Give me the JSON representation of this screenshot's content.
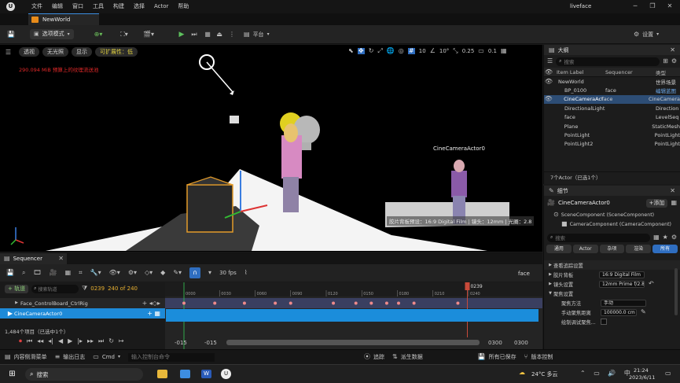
{
  "window": {
    "project": "NewWorld",
    "app_title": "liveface"
  },
  "menu": [
    "文件",
    "编辑",
    "窗口",
    "工具",
    "构建",
    "选择",
    "Actor",
    "帮助"
  ],
  "toolbar": {
    "mode": "选项模式",
    "platform": "平台",
    "settings": "设置"
  },
  "viewport": {
    "btn_perspective": "透视",
    "btn_lit": "无光照",
    "btn_show": "显示",
    "btn_scalability": "可扩展性：低",
    "warning": "290.094 MiB 预算上的纹理流送池",
    "grid_snap": "10",
    "rot_snap": "10°",
    "scale_snap": "0.25",
    "cam_speed": "0.1",
    "camera_label": "CineCameraActor0",
    "filmback_text": "胶片背板预设：16:9 Digital Film | 镜头：12mm | 光圈：2.8"
  },
  "outliner": {
    "title": "大纲",
    "search_placeholder": "搜索",
    "columns": {
      "label": "Item Label",
      "sequencer": "Sequencer",
      "type": "类型"
    },
    "rows": [
      {
        "label": "NewWorld",
        "seq": "",
        "type": "世界场景"
      },
      {
        "label": "BP_0100",
        "seq": "face",
        "type": "编辑蓝图"
      },
      {
        "label": "CineCameraActor0",
        "seq": "face",
        "type": "CineCamera"
      },
      {
        "label": "DirectionalLight",
        "seq": "",
        "type": "Direction"
      },
      {
        "label": "face",
        "seq": "",
        "type": "LevelSeq"
      },
      {
        "label": "Plane",
        "seq": "",
        "type": "StaticMesh"
      },
      {
        "label": "PointLight",
        "seq": "",
        "type": "PointLight"
      },
      {
        "label": "PointLight2",
        "seq": "",
        "type": "PointLight"
      }
    ],
    "footer": "7个Actor（已选1个）"
  },
  "details": {
    "title": "细节",
    "actor_name": "CineCameraActor0",
    "add": "+添加",
    "components": [
      "SceneComponent (SceneComponent)",
      "CameraComponent (CameraComponent)"
    ],
    "search_placeholder": "搜索",
    "filters": [
      "通用",
      "Actor",
      "杂项",
      "渲染",
      "所有"
    ],
    "sections": {
      "lookat": "查看追踪设置",
      "filmback": "胶片背板",
      "lens": "镜头设置",
      "focus": "聚焦设置"
    },
    "filmback_value": "16:9 Digital Film",
    "lens_value": "12mm Prime f/2.8",
    "focus_method_label": "聚焦方法",
    "focus_method_value": "手动",
    "focus_distance_label": "手动聚焦距离",
    "focus_distance_value": "100000.0 cm",
    "debug_focus_label": "绘制调试聚焦..."
  },
  "sequencer": {
    "tab": "Sequencer",
    "add_track": "+ 轨道",
    "search_placeholder": "搜索轨道",
    "frame_current": "0239",
    "frame_range": "240 of 240",
    "fps": "30 fps",
    "seq_name": "face",
    "playhead_label": "0239",
    "tracks": [
      {
        "label": "Face_ControlBoard_CtrlRig",
        "selected": false
      },
      {
        "label": "CineCameraActor0",
        "selected": true
      }
    ],
    "item_count": "1,484个项目（已选中1个）",
    "ticks": [
      "0000",
      "0030",
      "0060",
      "0090",
      "0120",
      "0150",
      "0180",
      "0210",
      "0240"
    ],
    "range_start": "-015",
    "range_start2": "-015",
    "range_end": "0300",
    "range_end2": "0300",
    "keyframes": [
      0,
      26,
      51,
      77,
      90,
      126,
      145,
      158,
      171,
      181,
      194,
      231
    ]
  },
  "statusbar": {
    "content_drawer": "内容侧滑菜单",
    "output_log": "输出日志",
    "cmd": "Cmd",
    "console_placeholder": "输入控制台命令",
    "trace": "追踪",
    "derived": "派生数据",
    "save_all": "所有已保存",
    "source_control": "版本控制"
  },
  "taskbar": {
    "search": "搜索",
    "weather": "24°C 多云",
    "time": "21:24",
    "date": "2023/6/11"
  }
}
